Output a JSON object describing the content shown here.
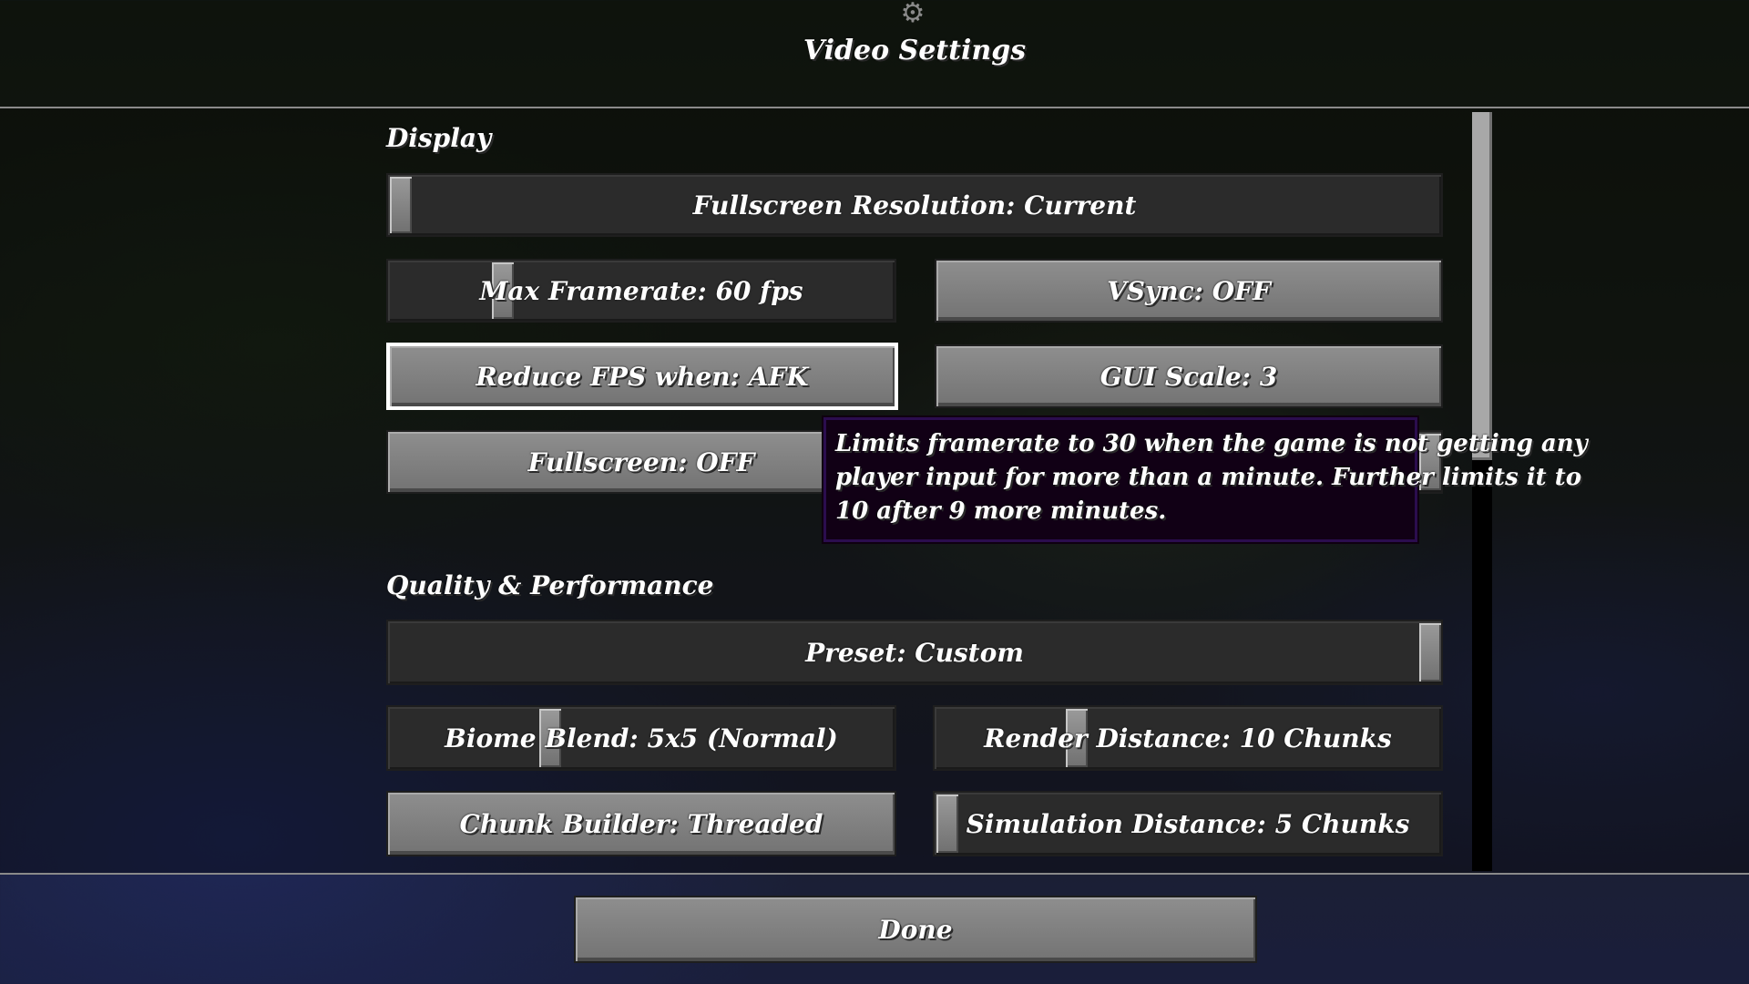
{
  "header": {
    "title": "Video Settings",
    "icon": "gear-icon"
  },
  "sections": {
    "display": "Display",
    "quality": "Quality & Performance"
  },
  "options": {
    "fullscreen_resolution": "Fullscreen Resolution: Current",
    "max_framerate": "Max Framerate: 60 fps",
    "vsync": "VSync: OFF",
    "reduce_fps": "Reduce FPS when: AFK",
    "gui_scale": "GUI Scale: 3",
    "fullscreen": "Fullscreen: OFF",
    "preset": "Preset: Custom",
    "biome_blend": "Biome Blend: 5x5 (Normal)",
    "render_distance": "Render Distance: 10 Chunks",
    "chunk_builder": "Chunk Builder: Threaded",
    "simulation_distance": "Simulation Distance: 5 Chunks"
  },
  "tooltip": {
    "lines": [
      "Limits framerate to 30 when the game is not getting any",
      "player input for more than a minute. Further limits it to",
      "10 after 9 more minutes."
    ]
  },
  "footer": {
    "done_label": "Done"
  },
  "colors": {
    "button_face": "#7f7f7f",
    "slider_face": "#2b2b2b",
    "focus_border": "#ffffff",
    "tooltip_bg": "#110015",
    "tooltip_border": "#2b0d4e"
  }
}
